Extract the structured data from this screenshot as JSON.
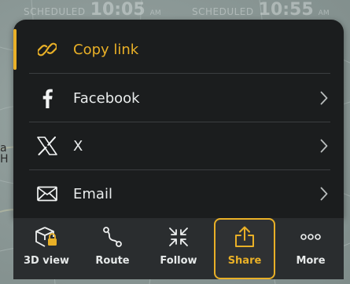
{
  "top_strip": {
    "left": {
      "label": "SCHEDULED",
      "time": "10:05",
      "ampm": "AM"
    },
    "right": {
      "label": "SCHEDULED",
      "time": "10:55",
      "ampm": "AM"
    }
  },
  "map": {
    "edge_text": "a\nH"
  },
  "share_sheet": {
    "items": [
      {
        "label": "Copy link",
        "icon": "link-icon",
        "highlighted": true
      },
      {
        "label": "Facebook",
        "icon": "facebook-icon",
        "chevron": false
      },
      {
        "label": "X",
        "icon": "x-logo-icon",
        "chevron": true
      },
      {
        "label": "Email",
        "icon": "envelope-icon",
        "chevron": true
      }
    ],
    "accent_color": "#e9b027"
  },
  "toolbar": {
    "items": [
      {
        "label": "3D view",
        "icon": "cube-lock-icon",
        "active": false
      },
      {
        "label": "Route",
        "icon": "route-icon",
        "active": false
      },
      {
        "label": "Follow",
        "icon": "collapse-arrows-icon",
        "active": false
      },
      {
        "label": "Share",
        "icon": "share-icon",
        "active": true
      },
      {
        "label": "More",
        "icon": "more-dots-icon",
        "active": false
      }
    ]
  }
}
